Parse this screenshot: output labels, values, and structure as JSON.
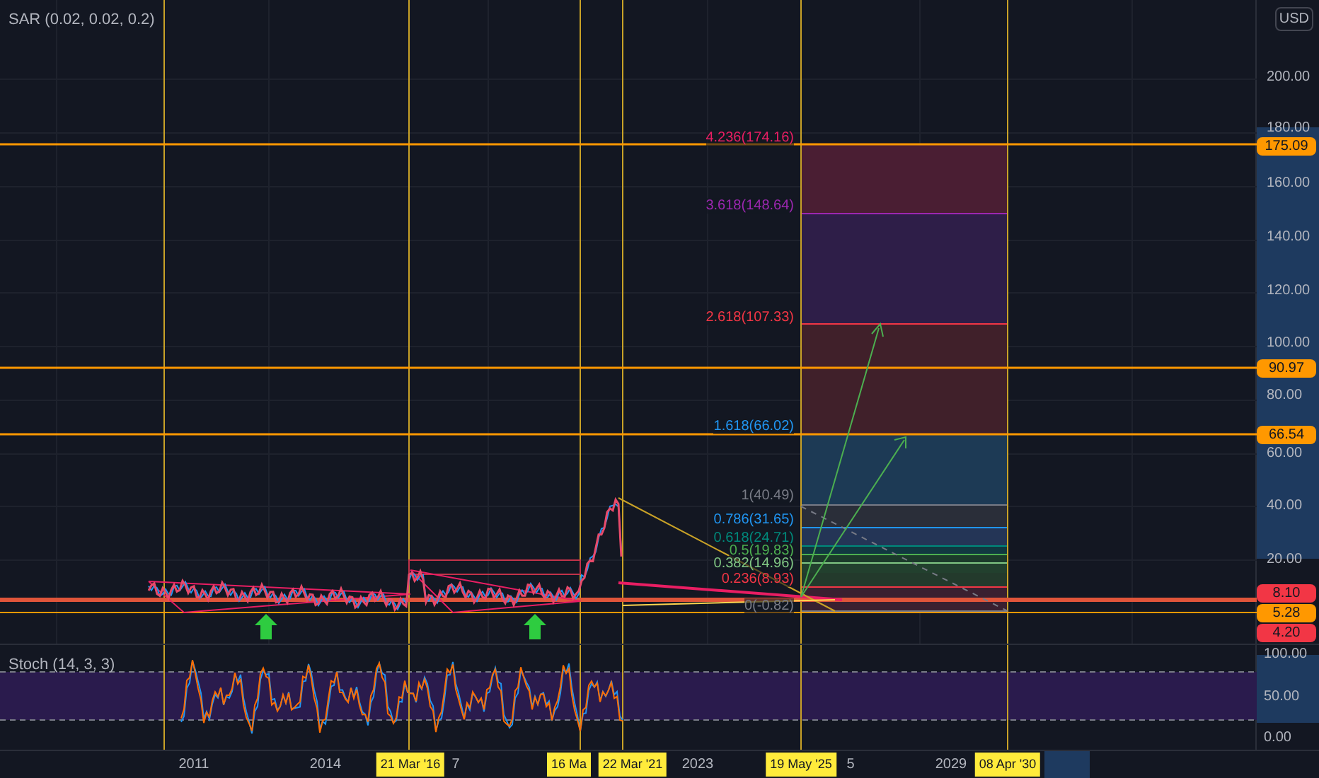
{
  "legend": {
    "sar": "SAR (0.02, 0.02, 0.2)",
    "stoch": "Stoch (14, 3, 3)"
  },
  "currency": "USD",
  "price_axis": [
    "200.00",
    "180.00",
    "160.00",
    "140.00",
    "120.00",
    "100.00",
    "80.00",
    "60.00",
    "40.00",
    "20.00"
  ],
  "price_markers": [
    {
      "text": "175.09",
      "color": "#ff9800"
    },
    {
      "text": "90.97",
      "color": "#ff9800"
    },
    {
      "text": "66.54",
      "color": "#ff9800"
    },
    {
      "text": "8.10",
      "color": "#f23645"
    },
    {
      "text": "5.28",
      "color": "#ff9800"
    },
    {
      "text": "4.20",
      "color": "#f23645"
    }
  ],
  "fib_levels": [
    {
      "text": "4.236(174.16)",
      "color": "#e91e63"
    },
    {
      "text": "3.618(148.64)",
      "color": "#9c27b0"
    },
    {
      "text": "2.618(107.33)",
      "color": "#f23645"
    },
    {
      "text": "1.618(66.02)",
      "color": "#2196f3"
    },
    {
      "text": "1(40.49)",
      "color": "#787b86"
    },
    {
      "text": "0.786(31.65)",
      "color": "#2196f3"
    },
    {
      "text": "0.618(24.71)",
      "color": "#00897b"
    },
    {
      "text": "0.5(19.83)",
      "color": "#4caf50"
    },
    {
      "text": "0.382(14.96)",
      "color": "#81c784"
    },
    {
      "text": "0.236(8.93)",
      "color": "#f23645"
    },
    {
      "text": "0(-0.82)",
      "color": "#787b86"
    }
  ],
  "stoch_axis": [
    "100.00",
    "50.00",
    "0.00"
  ],
  "time_axis": [
    {
      "text": "2011",
      "kind": "year"
    },
    {
      "text": "2014",
      "kind": "year"
    },
    {
      "text": "21 Mar '16",
      "kind": "marker"
    },
    {
      "text": "7",
      "kind": "year"
    },
    {
      "text": "16 Ma",
      "kind": "marker"
    },
    {
      "text": "22 Mar '21",
      "kind": "marker"
    },
    {
      "text": "2023",
      "kind": "year"
    },
    {
      "text": "19 May '25",
      "kind": "marker"
    },
    {
      "text": "5",
      "kind": "year"
    },
    {
      "text": "2029",
      "kind": "year"
    },
    {
      "text": "08 Apr '30",
      "kind": "marker"
    }
  ]
}
